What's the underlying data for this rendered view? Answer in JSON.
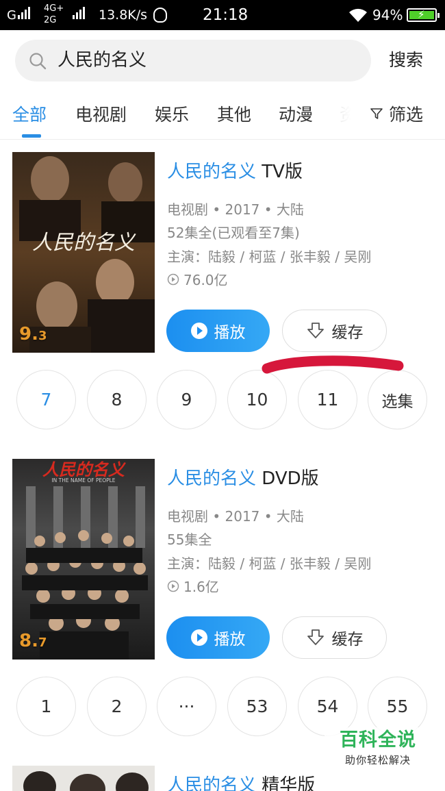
{
  "status_bar": {
    "network1": "G",
    "network2_top": "4G+",
    "network2_bottom": "2G",
    "speed": "13.8K/s",
    "time": "21:18",
    "battery": "94%"
  },
  "search": {
    "query": "人民的名义",
    "button_label": "搜索",
    "icon": "search-icon"
  },
  "tabs": {
    "items": [
      "全部",
      "电视剧",
      "娱乐",
      "其他",
      "动漫",
      "资"
    ],
    "active_index": 0,
    "filter_label": "筛选"
  },
  "results": [
    {
      "title_highlight": "人民的名义",
      "title_suffix": " TV版",
      "genre_year_region": "电视剧 • 2017 • 大陆",
      "episodes_info": "52集全(已观看至7集)",
      "cast": "主演：陆毅 / 柯蓝 / 张丰毅 / 吴刚",
      "views": "76.0亿",
      "rating_int": "9.",
      "rating_dec": "3",
      "poster_text": "人民的名义",
      "play_label": "播放",
      "cache_label": "缓存",
      "episode_buttons": [
        "7",
        "8",
        "9",
        "10",
        "11",
        "选集"
      ]
    },
    {
      "title_highlight": "人民的名义",
      "title_suffix": " DVD版",
      "genre_year_region": "电视剧 • 2017 • 大陆",
      "episodes_info": "55集全",
      "cast": "主演：陆毅 / 柯蓝 / 张丰毅 / 吴刚",
      "views": "1.6亿",
      "rating_int": "8.",
      "rating_dec": "7",
      "poster_text": "人民的名义",
      "poster_subtitle": "IN THE NAME OF PEOPLE",
      "play_label": "播放",
      "cache_label": "缓存",
      "episode_buttons": [
        "1",
        "2",
        "···",
        "53",
        "54",
        "55"
      ]
    },
    {
      "title_highlight": "人民的名义",
      "title_suffix": " 精华版"
    }
  ],
  "watermark": {
    "brand": "百科全说",
    "slogan": "助你轻松解决"
  },
  "colors": {
    "accent": "#2a8ee4",
    "play_gradient_start": "#1c8ff0",
    "annotation_red": "#d6173b",
    "watermark_green": "#2fb45a"
  }
}
